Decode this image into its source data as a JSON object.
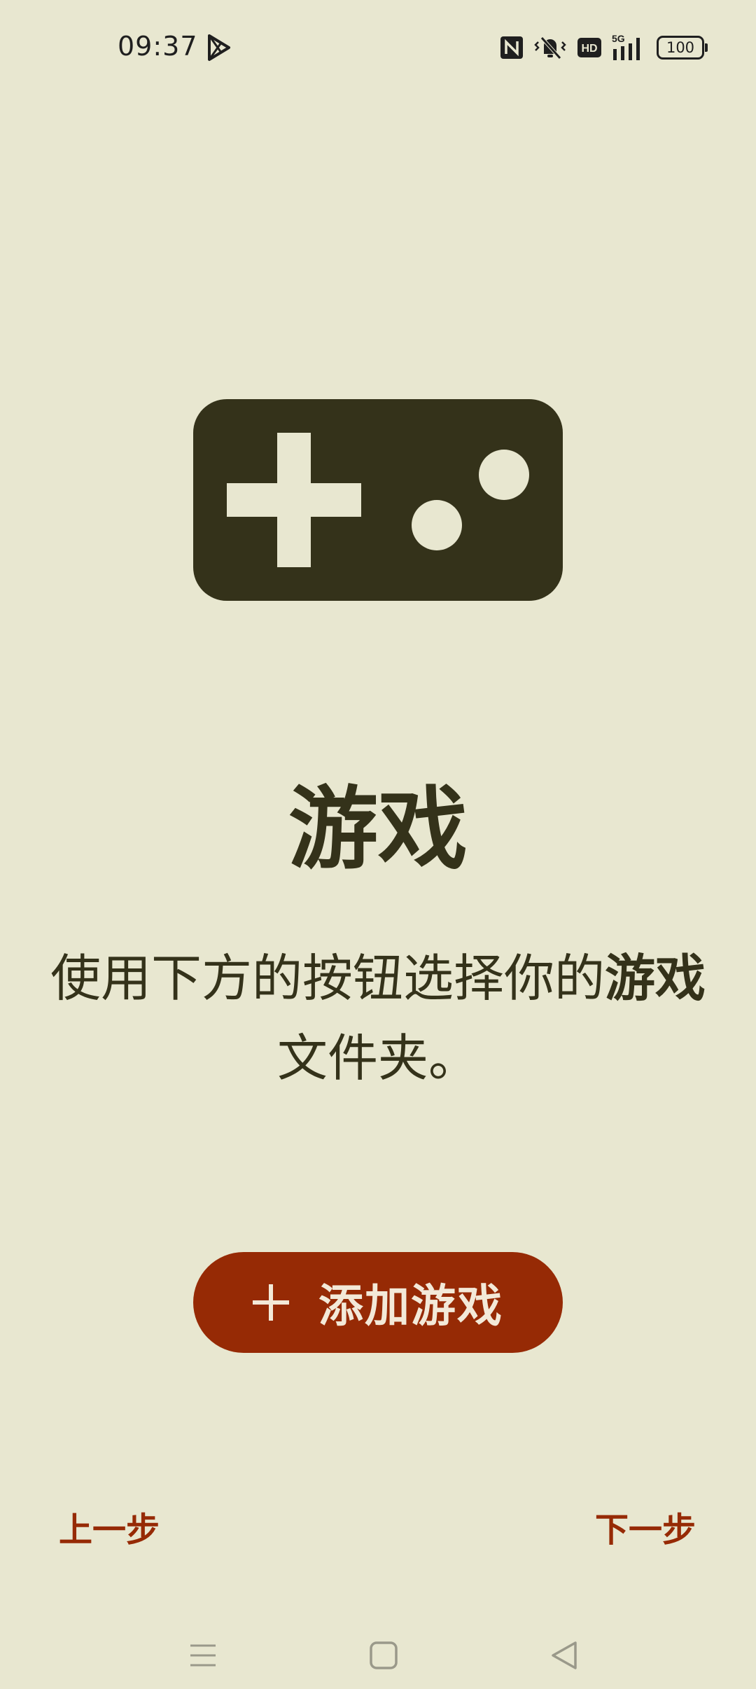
{
  "status_bar": {
    "time": "09:37",
    "icons": [
      "play-store-icon",
      "nfc-icon",
      "vibrate-mute-icon",
      "hd-icon",
      "5g-signal-icon"
    ],
    "hd_label": "HD",
    "network_label": "5G",
    "battery_level": "100"
  },
  "hero": {
    "icon": "gamepad-icon"
  },
  "content": {
    "title": "游戏",
    "description_prefix": "使用下方的按钮选择你的",
    "description_bold": "游戏",
    "description_suffix": "文件夹。"
  },
  "add_button": {
    "icon": "plus-icon",
    "label": "添加游戏"
  },
  "footer": {
    "prev_label": "上一步",
    "next_label": "下一步"
  },
  "nav_bar": {
    "icons": [
      "menu-icon",
      "home-icon",
      "back-icon"
    ]
  },
  "colors": {
    "background": "#e8e7d0",
    "dark": "#34321a",
    "accent": "#962a05",
    "button_text": "#f3e9d8"
  }
}
